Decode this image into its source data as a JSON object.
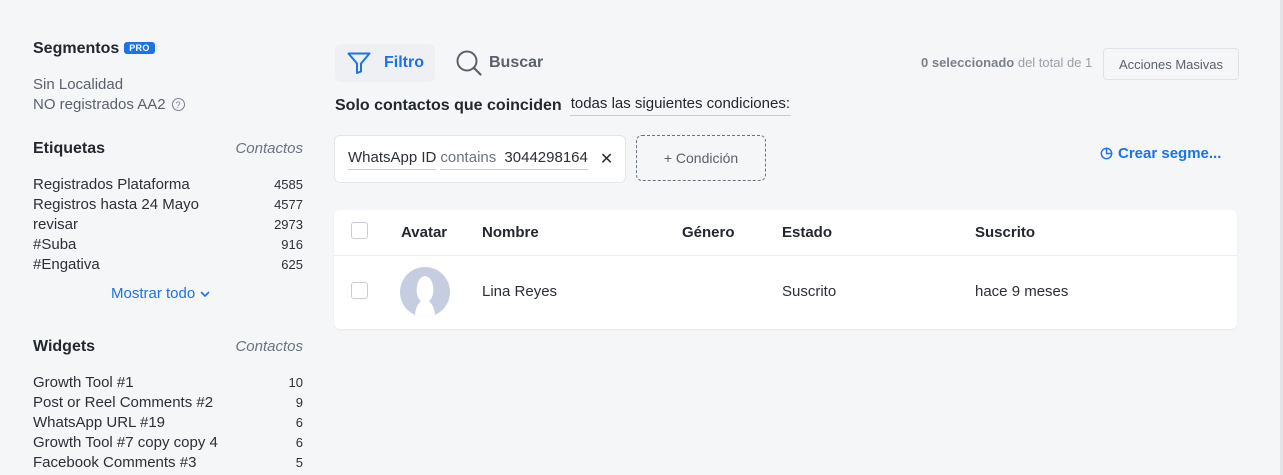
{
  "sidebar": {
    "segments": {
      "title": "Segmentos",
      "badge": "PRO",
      "items": [
        "Sin Localidad",
        "NO registrados AA2"
      ]
    },
    "tags": {
      "title": "Etiquetas",
      "column": "Contactos",
      "items": [
        {
          "label": "Registrados Plataforma",
          "count": "4585"
        },
        {
          "label": "Registros hasta 24 Mayo",
          "count": "4577"
        },
        {
          "label": "revisar",
          "count": "2973"
        },
        {
          "label": "#Suba",
          "count": "916"
        },
        {
          "label": "#Engativa",
          "count": "625"
        }
      ],
      "show_all": "Mostrar todo"
    },
    "widgets": {
      "title": "Widgets",
      "column": "Contactos",
      "items": [
        {
          "label": "Growth Tool #1",
          "count": "10"
        },
        {
          "label": "Post or Reel Comments #2",
          "count": "9"
        },
        {
          "label": "WhatsApp URL #19",
          "count": "6"
        },
        {
          "label": "Growth Tool #7 copy copy 4",
          "count": "6"
        },
        {
          "label": "Facebook Comments #3",
          "count": "5"
        }
      ]
    }
  },
  "toolbar": {
    "filter_label": "Filtro",
    "search_label": "Buscar",
    "selected_text": "0 seleccionado",
    "total_text": "del total de 1",
    "bulk_actions": "Acciones Masivas"
  },
  "conditions": {
    "prefix": "Solo contactos que coinciden",
    "mode": "todas las siguientes condiciones:",
    "chip": {
      "field": "WhatsApp ID",
      "operator": "contains",
      "value": "3044298164"
    },
    "add_label": "+ Condición",
    "create_segment": "Crear segme..."
  },
  "table": {
    "headers": {
      "avatar": "Avatar",
      "name": "Nombre",
      "gender": "Género",
      "status": "Estado",
      "subscribed": "Suscrito"
    },
    "rows": [
      {
        "name": "Lina Reyes",
        "gender": "",
        "status": "Suscrito",
        "subscribed": "hace 9 meses"
      }
    ]
  },
  "colors": {
    "accent": "#1a73e8",
    "background": "#f5f6f8",
    "avatar": "#c7cde0"
  }
}
